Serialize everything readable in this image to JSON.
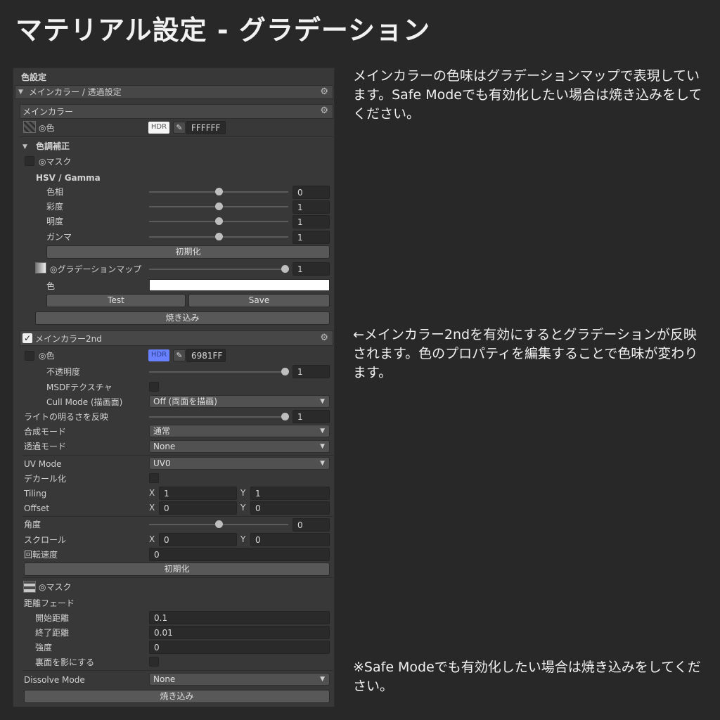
{
  "title": "マテリアル設定 - グラデーション",
  "notes": {
    "top": "メインカラーの色味はグラデーションマップで表現しています。Safe Modeでも有効化したい場合は焼き込みをしてください。",
    "middle": "←メインカラー2ndを有効にするとグラデーションが反映されます。色のプロパティを編集することで色味が変わります。",
    "bottom": "※Safe Modeでも有効化したい場合は焼き込みをしてください。"
  },
  "panel": {
    "heading": "色設定",
    "fold_header": "メインカラー / 透過設定",
    "main_color": {
      "header": "メインカラー",
      "color_label": "◎色",
      "hdr_tag": "HDR",
      "hex": "FFFFFF",
      "tone_header": "色調補正",
      "mask_label": "◎マスク",
      "hsv_label": "HSV / Gamma",
      "sliders": [
        {
          "label": "色相",
          "value": "0",
          "pos": 0.5
        },
        {
          "label": "彩度",
          "value": "1",
          "pos": 0.5
        },
        {
          "label": "明度",
          "value": "1",
          "pos": 0.5
        },
        {
          "label": "ガンマ",
          "value": "1",
          "pos": 0.5
        }
      ],
      "reset_label": "初期化",
      "gradation_label": "◎グラデーションマップ",
      "gradation_value": "1",
      "gradation_pos": 0.97,
      "gradient_color_label": "色",
      "test_label": "Test",
      "save_label": "Save",
      "bake_label": "焼き込み"
    },
    "main_color_2nd": {
      "header": "メインカラー2nd",
      "enabled": true,
      "color_label": "◎色",
      "hdr_tag": "HDR",
      "hex": "6981FF",
      "swatch_color": "#6981FF",
      "opacity_label": "不透明度",
      "opacity_value": "1",
      "opacity_pos": 0.97,
      "msdf_label": "MSDFテクスチャ",
      "cull_label": "Cull Mode (描画面)",
      "cull_value": "Off (両面を描画)",
      "light_label": "ライトの明るさを反映",
      "light_value": "1",
      "light_pos": 0.97,
      "blend_label": "合成モード",
      "blend_value": "通常",
      "transp_label": "透過モード",
      "transp_value": "None",
      "uv_label": "UV Mode",
      "uv_value": "UV0",
      "decal_label": "デカール化",
      "tiling_label": "Tiling",
      "tiling_x": "1",
      "tiling_y": "1",
      "offset_label": "Offset",
      "offset_x": "0",
      "offset_y": "0",
      "angle_label": "角度",
      "angle_value": "0",
      "angle_pos": 0.5,
      "scroll_label": "スクロール",
      "scroll_x": "0",
      "scroll_y": "0",
      "rotate_label": "回転速度",
      "rotate_value": "0",
      "reset_label": "初期化",
      "mask_label": "◎マスク",
      "fade_label": "距離フェード",
      "fade_start_label": "開始距離",
      "fade_start": "0.1",
      "fade_end_label": "終了距離",
      "fade_end": "0.01",
      "fade_strength_label": "強度",
      "fade_strength": "0",
      "backface_label": "裏面を影にする",
      "dissolve_label": "Dissolve Mode",
      "dissolve_value": "None",
      "bake_label": "焼き込み"
    },
    "x_label": "X",
    "y_label": "Y"
  },
  "colors": {
    "background": "#282828",
    "panel": "#383838",
    "accent_2nd": "#6981FF"
  },
  "icons": [
    "gear-icon",
    "triangle-down-icon",
    "eyedropper-icon",
    "checkmark-icon",
    "texture-thumbnail-icon"
  ]
}
